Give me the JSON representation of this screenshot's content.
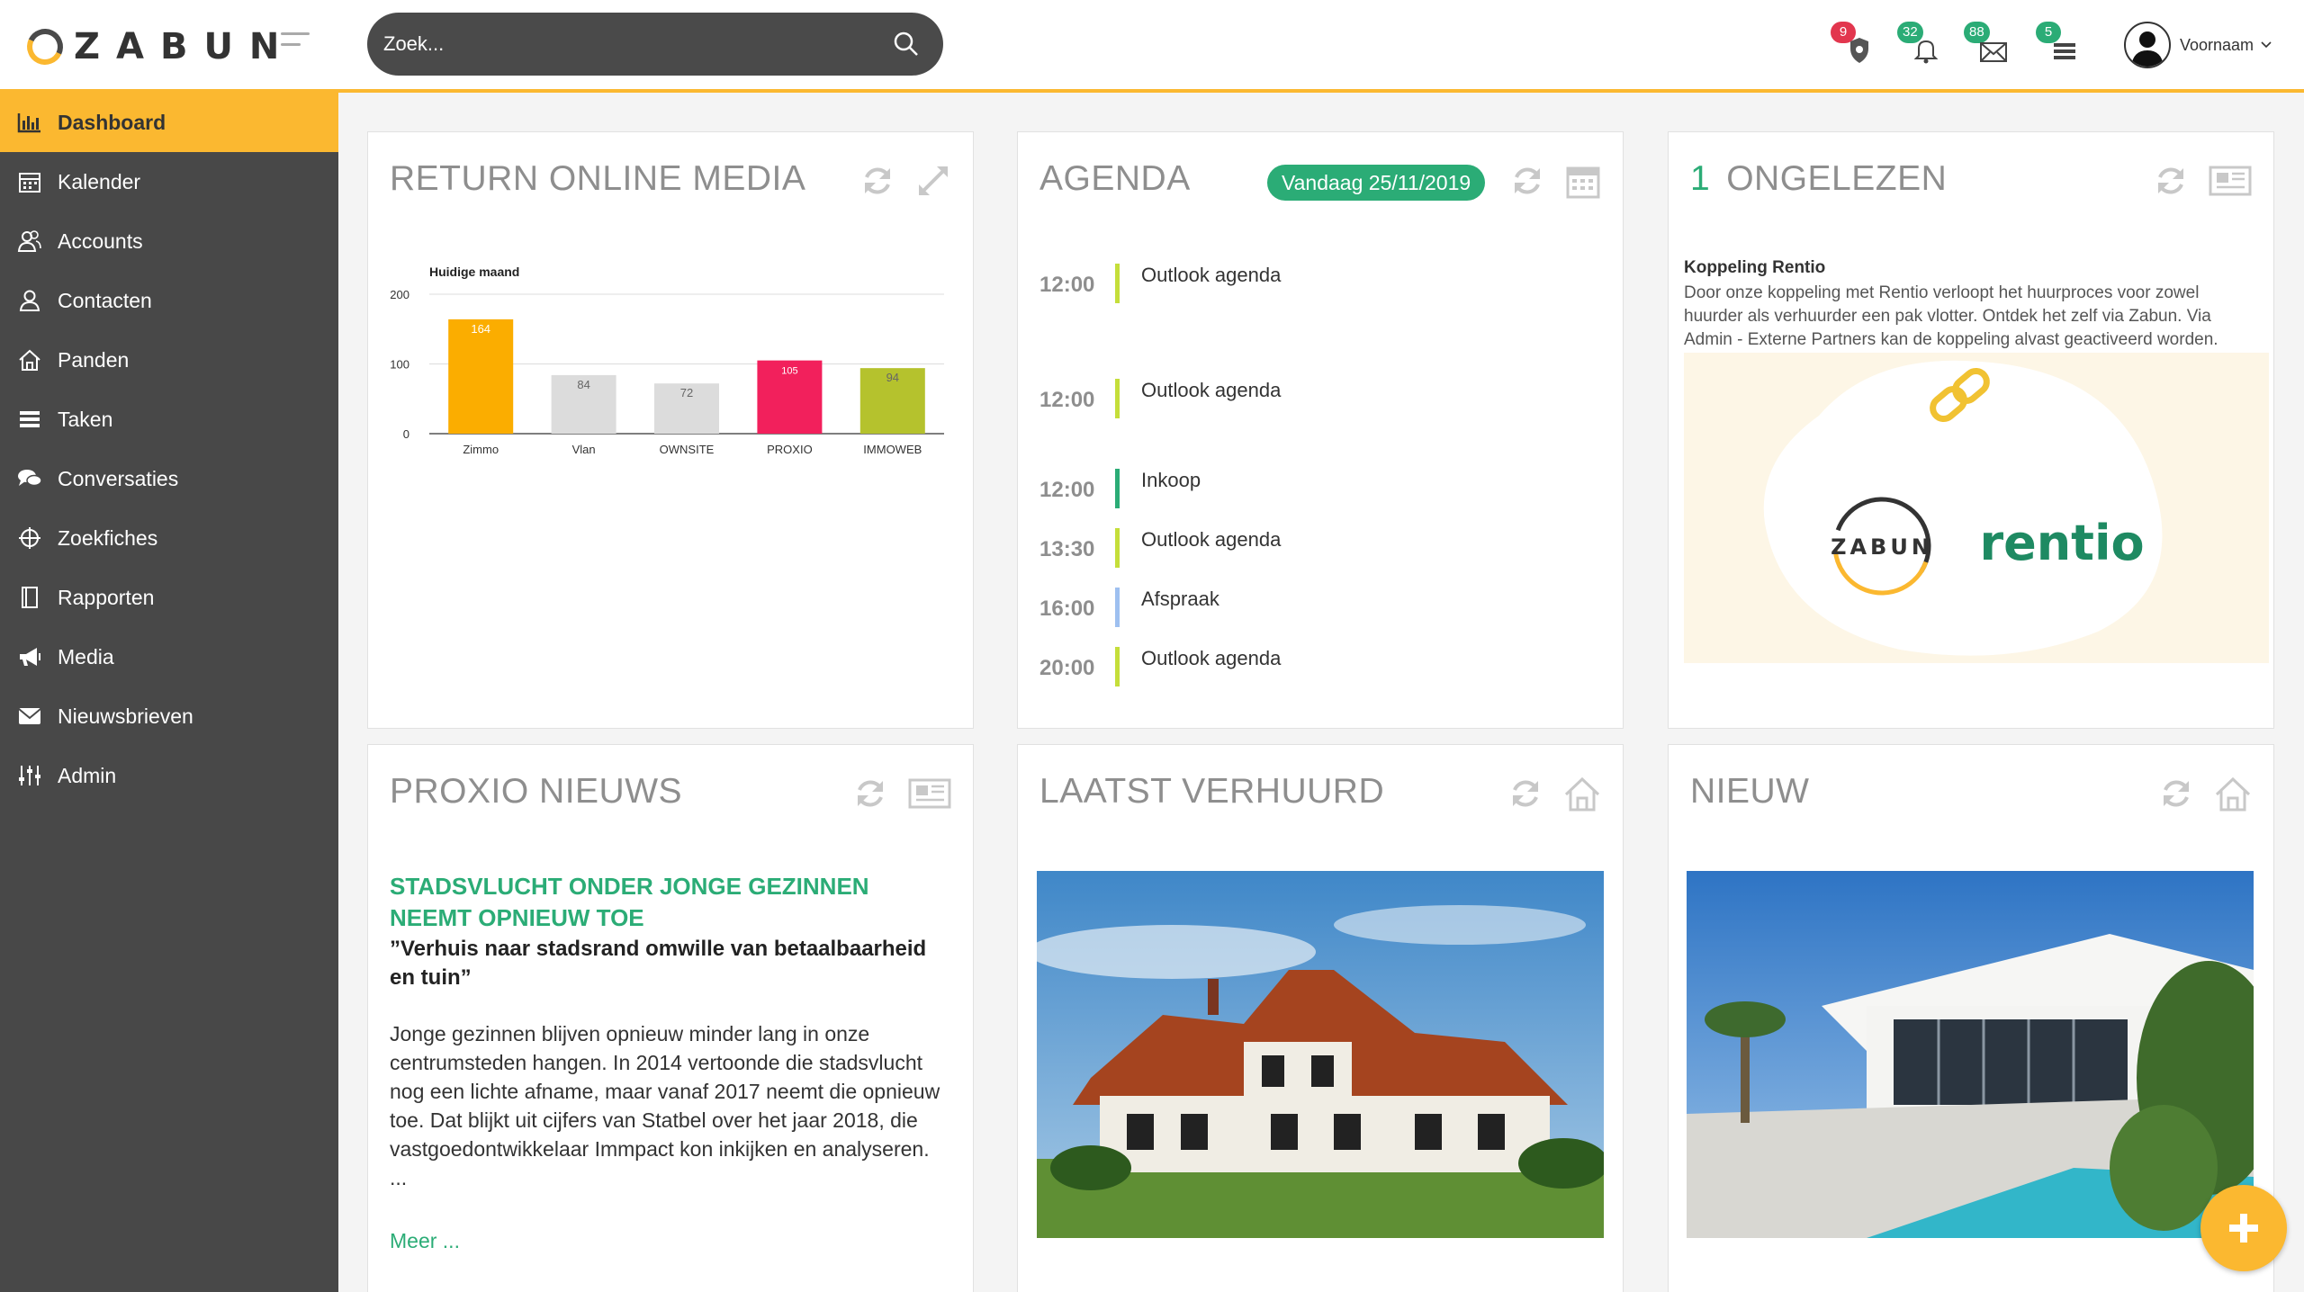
{
  "brand": {
    "name": "ZABUN",
    "accent": "#fbb830",
    "sidebar_bg": "#484848",
    "green": "#2bac76"
  },
  "search": {
    "placeholder": "Zoek..."
  },
  "header_icons": [
    {
      "name": "notifications-icon",
      "badge": "9",
      "badge_color": "red"
    },
    {
      "name": "bell-icon",
      "badge": "32",
      "badge_color": "green"
    },
    {
      "name": "mail-icon",
      "badge": "88",
      "badge_color": "green"
    },
    {
      "name": "tasks-icon",
      "badge": "5",
      "badge_color": "green"
    }
  ],
  "user": {
    "name": "Voornaam"
  },
  "sidebar": {
    "items": [
      {
        "label": "Dashboard",
        "icon": "bar-chart-icon",
        "active": true
      },
      {
        "label": "Kalender",
        "icon": "calendar-icon"
      },
      {
        "label": "Accounts",
        "icon": "users-icon"
      },
      {
        "label": "Contacten",
        "icon": "user-icon"
      },
      {
        "label": "Panden",
        "icon": "home-icon"
      },
      {
        "label": "Taken",
        "icon": "tasks-icon"
      },
      {
        "label": "Conversaties",
        "icon": "chat-icon"
      },
      {
        "label": "Zoekfiches",
        "icon": "crosshair-icon"
      },
      {
        "label": "Rapporten",
        "icon": "report-icon"
      },
      {
        "label": "Media",
        "icon": "megaphone-icon"
      },
      {
        "label": "Nieuwsbrieven",
        "icon": "envelope-icon"
      },
      {
        "label": "Admin",
        "icon": "sliders-icon"
      }
    ]
  },
  "cards": {
    "media": {
      "title": "RETURN ONLINE MEDIA"
    },
    "agenda": {
      "title": "AGENDA",
      "today": "Vandaag 25/11/2019",
      "items": [
        {
          "time": "12:00",
          "label": "Outlook agenda",
          "color": "#c5de3a"
        },
        {
          "time": "12:00",
          "label": "Outlook agenda",
          "color": "#c5de3a"
        },
        {
          "time": "12:00",
          "label": "Inkoop",
          "color": "#2bac76"
        },
        {
          "time": "13:30",
          "label": "Outlook agenda",
          "color": "#c5de3a"
        },
        {
          "time": "16:00",
          "label": "Afspraak",
          "color": "#9ec0f0"
        },
        {
          "time": "20:00",
          "label": "Outlook agenda",
          "color": "#c5de3a"
        }
      ]
    },
    "unread": {
      "count": "1",
      "title": "ONGELEZEN",
      "item_title": "Koppeling Rentio",
      "item_text": "Door onze koppeling met Rentio verloopt het huurproces voor zowel huurder als verhuurder een pak vlotter. Ontdek het zelf via Zabun. Via Admin - Externe Partners kan de koppeling alvast geactiveerd worden.",
      "logo_left": "ZABUN",
      "logo_right": "rentio"
    },
    "news": {
      "title": "PROXIO NIEUWS",
      "headline": "STADSVLUCHT ONDER JONGE GEZINNEN NEEMT OPNIEUW TOE",
      "subtitle": "”Verhuis naar stadsrand omwille van betaalbaarheid en tuin”",
      "body": "Jonge gezinnen blijven opnieuw minder lang in onze centrumsteden hangen. In 2014 vertoonde die stadsvlucht nog een lichte afname, maar vanaf 2017 neemt die opnieuw toe. Dat blijkt uit cijfers van Statbel over het jaar 2018, die vastgoedontwikkelaar Immpact kon inkijken en analyseren. ...",
      "more": "Meer ..."
    },
    "rented": {
      "title": "LAATST VERHUURD"
    },
    "new": {
      "title": "NIEUW"
    }
  },
  "chart_data": {
    "type": "bar",
    "title": "Huidige maand",
    "categories": [
      "Zimmo",
      "Vlan",
      "OWNSITE",
      "PROXIO",
      "IMMOWEB"
    ],
    "values": [
      164,
      84,
      72,
      105,
      94
    ],
    "colors": [
      "#fbad00",
      "#dcdcdc",
      "#dcdcdc",
      "#f2205c",
      "#b5c22d"
    ],
    "yticks": [
      0,
      100,
      200
    ],
    "ylim": [
      0,
      200
    ],
    "xlabel": "",
    "ylabel": ""
  }
}
